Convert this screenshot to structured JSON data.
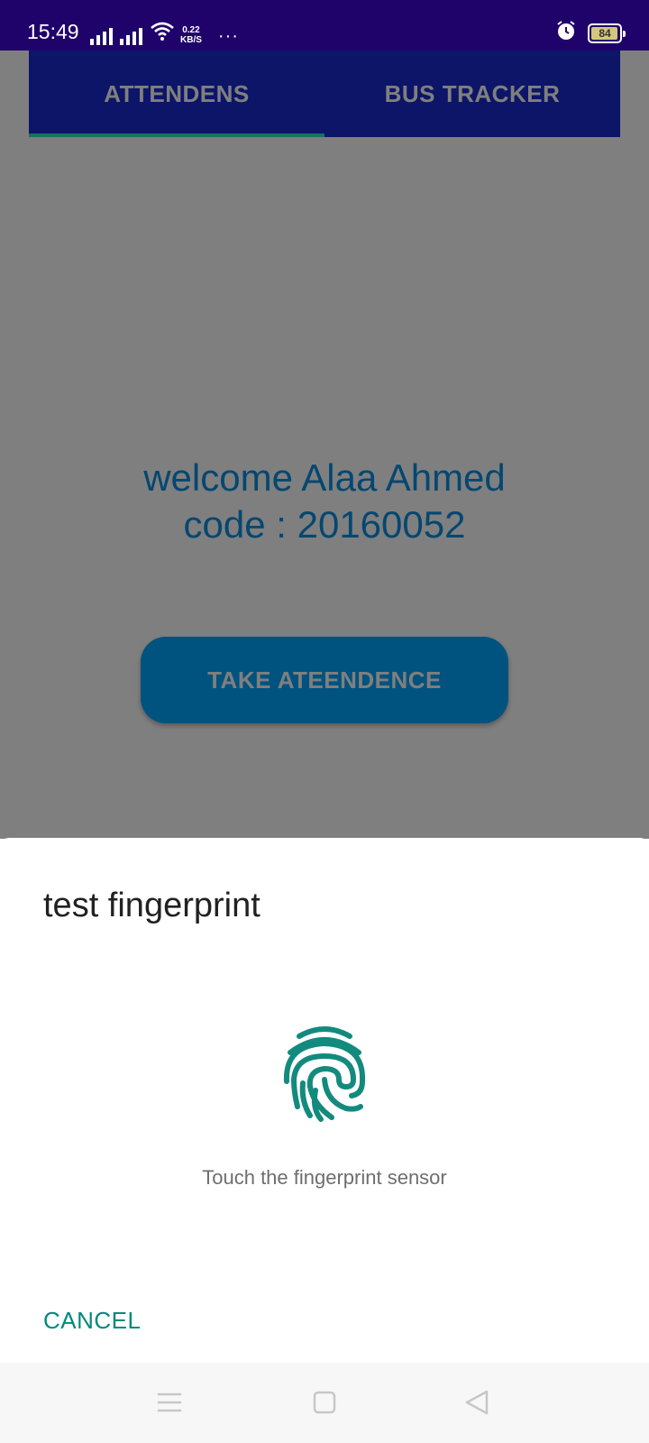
{
  "status_bar": {
    "time": "15:49",
    "net_speed_value": "0.22",
    "net_speed_unit": "KB/S",
    "more": "···",
    "battery_level": "84",
    "icons": [
      "signal-icon",
      "signal-icon",
      "wifi-icon",
      "alarm-icon",
      "battery-icon"
    ]
  },
  "tabs": [
    {
      "label": "ATTENDENS",
      "active": true
    },
    {
      "label": "BUS TRACKER",
      "active": false
    }
  ],
  "main": {
    "welcome_line": "welcome Alaa Ahmed",
    "code_line": "code : 20160052",
    "take_button": "TAKE ATEENDENCE"
  },
  "dialog": {
    "title": "test fingerprint",
    "icon": "fingerprint-icon",
    "hint": "Touch the fingerprint sensor",
    "cancel": "CANCEL"
  },
  "nav_bar": {
    "items": [
      "menu-icon",
      "home-icon",
      "back-icon"
    ]
  },
  "colors": {
    "status_bar": "#1f036b",
    "tab_bar": "#1a2bd0",
    "tab_indicator": "#2ce5c0",
    "welcome_text": "#0b8fe0",
    "button": "#00a7ff",
    "accent": "#00897b"
  }
}
